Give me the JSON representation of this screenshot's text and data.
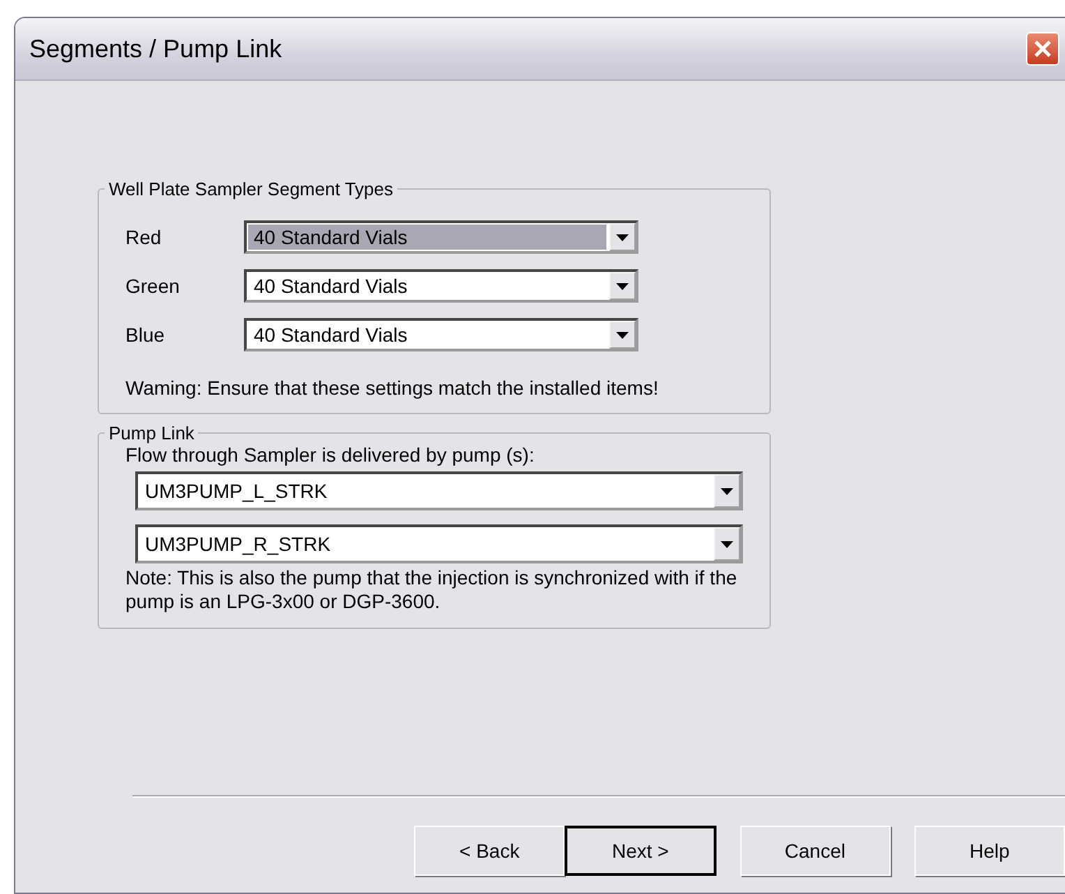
{
  "window": {
    "title": "Segments / Pump Link"
  },
  "segment_types": {
    "title": "Well Plate Sampler Segment Types",
    "rows": [
      {
        "label": "Red",
        "value": "40 Standard Vials",
        "highlighted": true
      },
      {
        "label": "Green",
        "value": "40 Standard Vials",
        "highlighted": false
      },
      {
        "label": "Blue",
        "value": "40 Standard Vials",
        "highlighted": false
      }
    ],
    "warning": "Waming: Ensure that these settings match the installed items!"
  },
  "pump_link": {
    "title": "Pump Link",
    "intro": "Flow through Sampler is delivered by pump (s):",
    "pumps": [
      "UM3PUMP_L_STRK",
      "UM3PUMP_R_STRK"
    ],
    "note": "Note: This is also the pump that the injection is synchronized with if the pump is an LPG-3x00 or DGP-3600."
  },
  "buttons": [
    {
      "label": "< Back",
      "default": false
    },
    {
      "label": "Next >",
      "default": true
    },
    {
      "label": "Cancel",
      "default": false
    },
    {
      "label": "Help",
      "default": false
    }
  ]
}
